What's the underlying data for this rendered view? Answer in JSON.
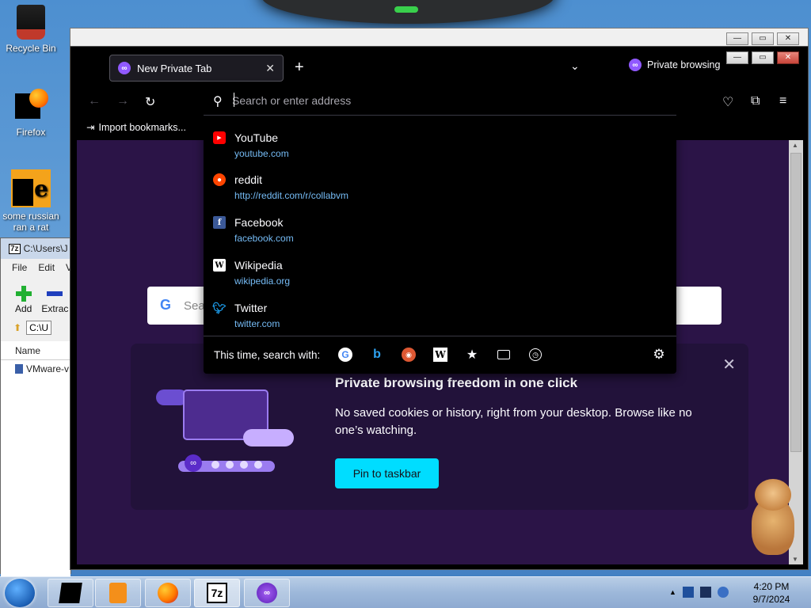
{
  "desktop": {
    "icons": [
      {
        "label": "Recycle Bin"
      },
      {
        "label": "Firefox"
      },
      {
        "label": "some russian ran a rat"
      }
    ]
  },
  "zip_window": {
    "title": "C:\\Users\\J",
    "menu": [
      "File",
      "Edit",
      "V"
    ],
    "tools": [
      "Add",
      "Extrac"
    ],
    "path": "C:\\U",
    "column": "Name",
    "files": [
      "VMware-v"
    ]
  },
  "browser": {
    "tab_title": "New Private Tab",
    "new_tab": "+",
    "private_label": "Private browsing",
    "import_bookmarks": "Import bookmarks...",
    "urlbar_placeholder": "Search or enter address",
    "suggestions": [
      {
        "title": "YouTube",
        "url": "youtube.com",
        "icon": "youtube-icon"
      },
      {
        "title": "reddit",
        "url": "http://reddit.com/r/collabvm",
        "icon": "reddit-icon"
      },
      {
        "title": "Facebook",
        "url": "facebook.com",
        "icon": "facebook-icon"
      },
      {
        "title": "Wikipedia",
        "url": "wikipedia.org",
        "icon": "wikipedia-icon"
      },
      {
        "title": "Twitter",
        "url": "twitter.com",
        "icon": "twitter-icon"
      }
    ],
    "search_with_label": "This time, search with:",
    "content_search_placeholder": "Sea",
    "promo": {
      "title": "Private browsing freedom in one click",
      "body": "No saved cookies or history, right from your desktop. Browse like no one’s watching.",
      "button": "Pin to taskbar"
    }
  },
  "taskbar": {
    "time": "4:20 PM",
    "date": "9/7/2024",
    "apps": [
      "terminal",
      "media player",
      "firefox",
      "7-Zip",
      "private browsing"
    ],
    "z7_label": "7z"
  }
}
